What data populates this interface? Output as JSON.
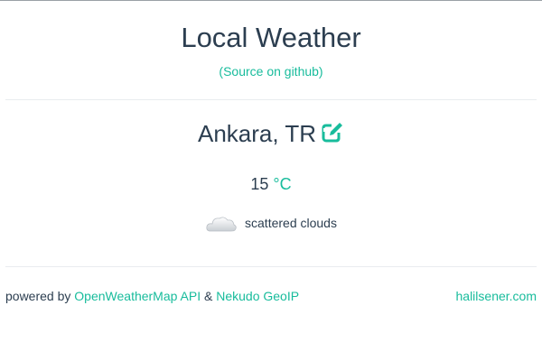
{
  "header": {
    "title": "Local Weather",
    "source_link": "(Source on github)"
  },
  "weather": {
    "location": "Ankara, TR",
    "temperature": "15",
    "unit": "°C",
    "condition": "scattered clouds",
    "condition_icon": "cloud-icon"
  },
  "footer": {
    "powered_by": "powered by ",
    "api_link": "OpenWeatherMap API",
    "amp": " & ",
    "geoip_link": "Nekudo GeoIP",
    "author_link": "halilsener.com"
  },
  "colors": {
    "accent": "#18bc9c",
    "text": "#2c3e50",
    "divider": "#e9ecef"
  }
}
